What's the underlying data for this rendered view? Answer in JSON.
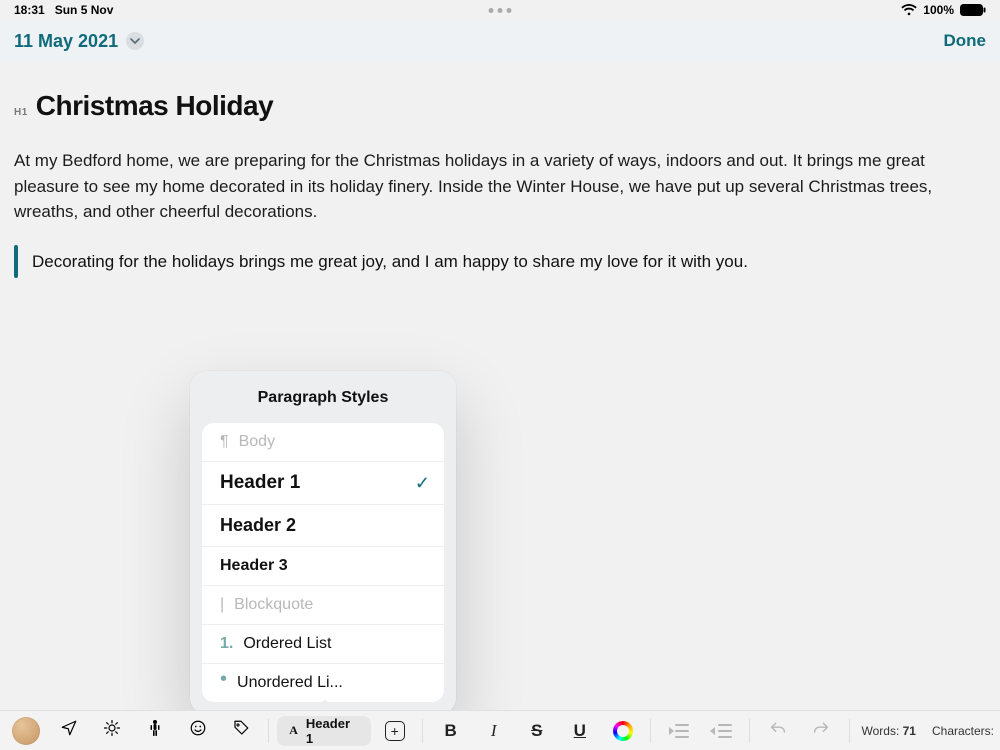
{
  "status": {
    "time": "18:31",
    "date": "Sun 5 Nov",
    "battery": "100%"
  },
  "nav": {
    "title": "11 May 2021",
    "done": "Done"
  },
  "doc": {
    "h1_badge": "H1",
    "h1": "Christmas Holiday",
    "body": "At my Bedford home, we are preparing for the Christmas holidays in a variety of ways, indoors and out. It brings me great pleasure to see my home decorated in its holiday finery. Inside the Winter House, we have put up several Christmas trees, wreaths, and other cheerful decorations.",
    "quote": "Decorating for the holidays brings me great joy, and I am happy to share my love for it with you."
  },
  "popover": {
    "title": "Paragraph Styles",
    "body_pilcrow": "¶",
    "body": "Body",
    "h1": "Header 1",
    "h2": "Header 2",
    "h3": "Header 3",
    "bq_mark": "|",
    "bq": "Blockquote",
    "ol_idx": "1.",
    "ol": "Ordered List",
    "ul_dot": "•",
    "ul": "Unordered Li..."
  },
  "toolbar": {
    "style_prefix": "A",
    "style_label": "Header 1",
    "bold": "B",
    "italic": "I",
    "strike": "S",
    "underline": "U",
    "words_label": "Words:",
    "words_value": "71",
    "chars_label": "Characters:"
  }
}
